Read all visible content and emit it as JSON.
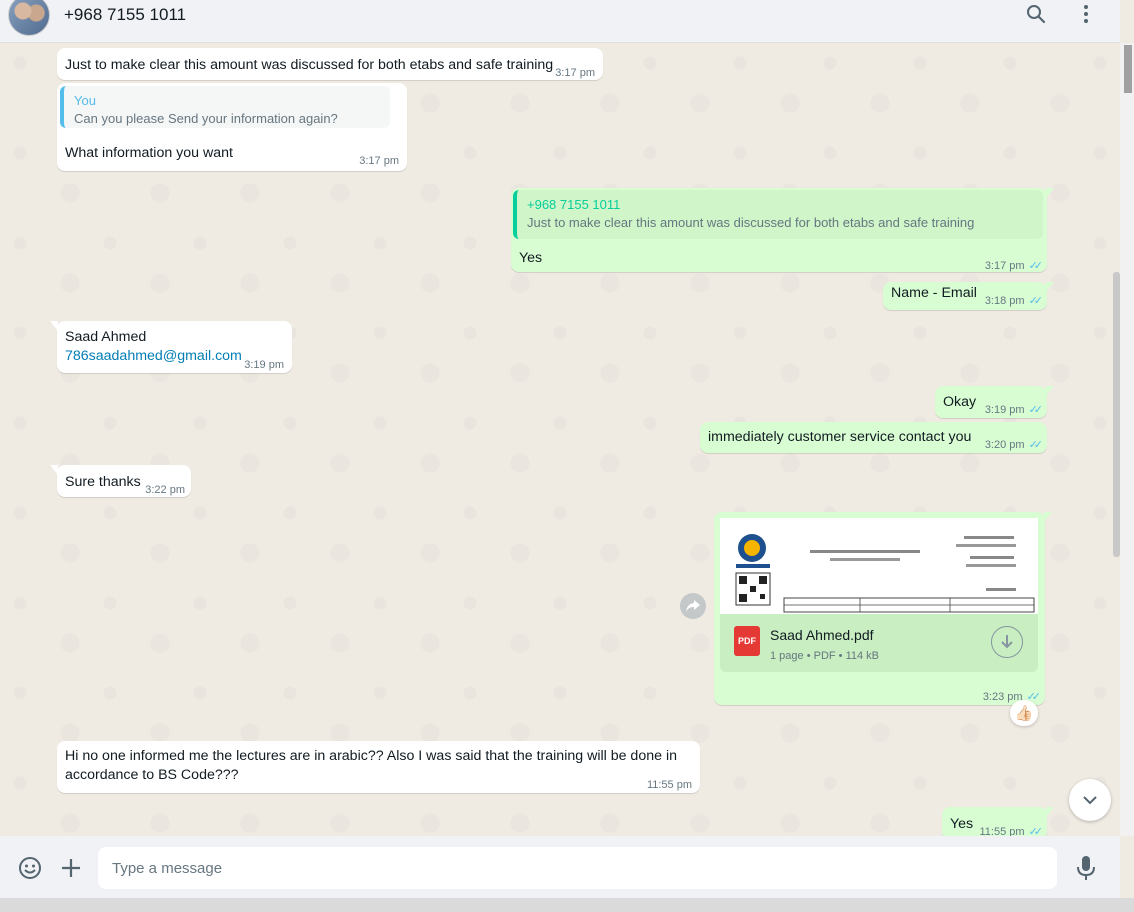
{
  "header": {
    "contact_name": "+968 7155 1011",
    "search_icon": "search-icon",
    "menu_icon": "more-vertical-icon"
  },
  "messages": [
    {
      "dir": "in",
      "text": "Just to make clear this amount was discussed for both etabs and safe training",
      "time": "3:17 pm"
    },
    {
      "dir": "in",
      "quote_author": "You",
      "quote_text": "Can you please Send your information again?",
      "text": "What information you want",
      "time": "3:17 pm"
    },
    {
      "dir": "out",
      "quote_author": "+968 7155 1011",
      "quote_text": "Just to make clear this amount was discussed for both etabs and safe training",
      "text": "Yes",
      "time": "3:17 pm"
    },
    {
      "dir": "out",
      "text": "Name - Email",
      "time": "3:18 pm"
    },
    {
      "dir": "in",
      "text": "Saad Ahmed",
      "link": "786saadahmed@gmail.com",
      "time": "3:19 pm"
    },
    {
      "dir": "out",
      "text": "Okay",
      "time": "3:19 pm"
    },
    {
      "dir": "out",
      "text": "immediately customer service contact  you",
      "time": "3:20 pm"
    },
    {
      "dir": "in",
      "text": "Sure thanks",
      "time": "3:22 pm"
    },
    {
      "dir": "out",
      "file_name": "Saad Ahmed.pdf",
      "file_meta": "1 page • PDF • 114 kB",
      "file_badge": "PDF",
      "time": "3:23 pm",
      "reaction": "👍🏻"
    },
    {
      "dir": "in",
      "text": "Hi no one informed me the lectures are in arabic?? Also I was said that the training will be done in accordance to BS Code???",
      "time": "11:55 pm"
    },
    {
      "dir": "out",
      "text": "Yes",
      "time": "11:55 pm"
    }
  ],
  "composer": {
    "placeholder": "Type a message",
    "emoji_icon": "emoji-icon",
    "attach_icon": "plus-icon",
    "mic_icon": "microphone-icon"
  },
  "ticks": "✓✓"
}
